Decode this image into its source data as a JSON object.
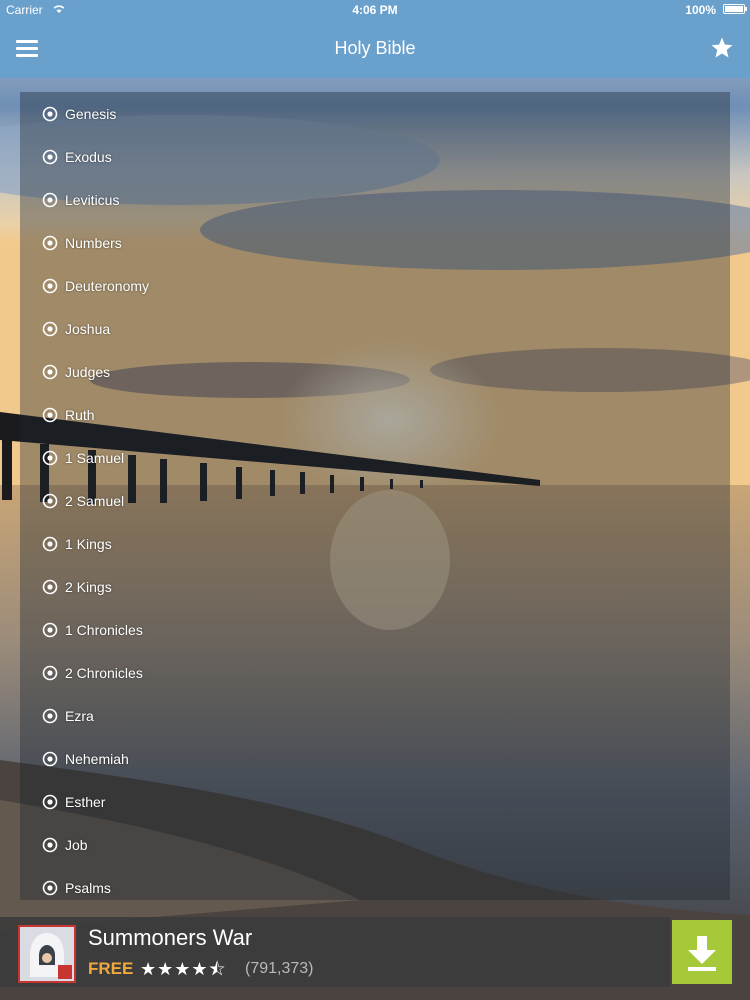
{
  "status_bar": {
    "carrier": "Carrier",
    "time": "4:06 PM",
    "battery": "100%"
  },
  "header": {
    "title": "Holy Bible",
    "menu_icon": "hamburger-menu-icon",
    "favorite_icon": "star-icon"
  },
  "books": [
    {
      "name": "Genesis"
    },
    {
      "name": "Exodus"
    },
    {
      "name": "Leviticus"
    },
    {
      "name": "Numbers"
    },
    {
      "name": "Deuteronomy"
    },
    {
      "name": "Joshua"
    },
    {
      "name": "Judges"
    },
    {
      "name": "Ruth"
    },
    {
      "name": "1 Samuel"
    },
    {
      "name": "2 Samuel"
    },
    {
      "name": "1 Kings"
    },
    {
      "name": "2 Kings"
    },
    {
      "name": "1 Chronicles"
    },
    {
      "name": "2 Chronicles"
    },
    {
      "name": "Ezra"
    },
    {
      "name": "Nehemiah"
    },
    {
      "name": "Esther"
    },
    {
      "name": "Job"
    },
    {
      "name": "Psalms"
    }
  ],
  "ad": {
    "app_name": "Summoners War",
    "price": "FREE",
    "rating": 4.5,
    "rating_stars": "★★★★⯪",
    "reviews": "(791,373)",
    "download_icon": "download-icon"
  },
  "colors": {
    "nav_bar": "#6aa0cc",
    "price": "#f0a93c",
    "download_button": "#a6c93a"
  }
}
